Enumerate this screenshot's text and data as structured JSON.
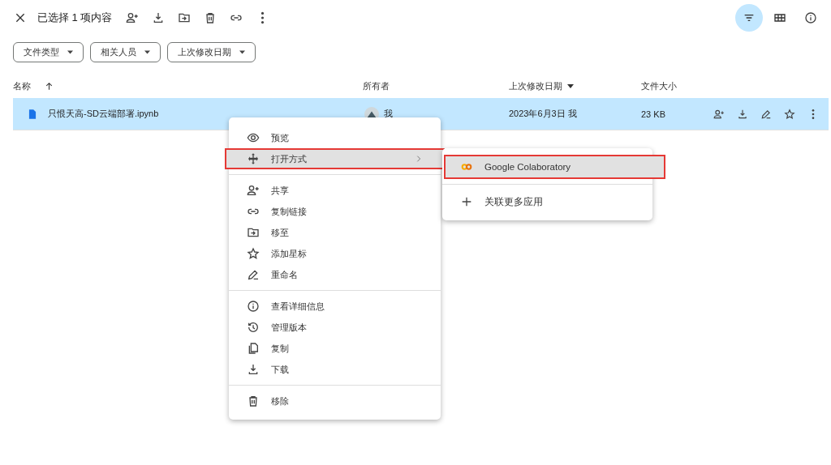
{
  "toolbar": {
    "selection_text": "已选择 1 项内容",
    "filter_active": true
  },
  "filters": [
    "文件类型",
    "相关人员",
    "上次修改日期"
  ],
  "table": {
    "columns": [
      "名称",
      "所有者",
      "上次修改日期",
      "文件大小"
    ],
    "rows": [
      {
        "name": "只恨天高-SD云端部署.ipynb",
        "owner": "我",
        "modified": "2023年6月3日 我",
        "size": "23 KB",
        "selected": true
      }
    ]
  },
  "context_menu": {
    "groups": [
      [
        {
          "label": "预览",
          "kind": "action",
          "highlighted": false
        },
        {
          "label": "打开方式",
          "kind": "submenu",
          "highlighted": true
        }
      ],
      [
        {
          "label": "共享",
          "kind": "action",
          "highlighted": false
        },
        {
          "label": "复制链接",
          "kind": "action",
          "highlighted": false
        },
        {
          "label": "移至",
          "kind": "action",
          "highlighted": false
        },
        {
          "label": "添加星标",
          "kind": "action",
          "highlighted": false
        },
        {
          "label": "重命名",
          "kind": "action",
          "highlighted": false
        }
      ],
      [
        {
          "label": "查看详细信息",
          "kind": "action",
          "highlighted": false
        },
        {
          "label": "管理版本",
          "kind": "action",
          "highlighted": false
        },
        {
          "label": "复制",
          "kind": "action",
          "highlighted": false
        },
        {
          "label": "下载",
          "kind": "action",
          "highlighted": false
        }
      ],
      [
        {
          "label": "移除",
          "kind": "action",
          "highlighted": false
        }
      ]
    ]
  },
  "submenu": {
    "items": [
      {
        "label": "Google Colaboratory",
        "highlighted": true
      },
      {
        "label": "关联更多应用",
        "highlighted": false
      }
    ]
  }
}
